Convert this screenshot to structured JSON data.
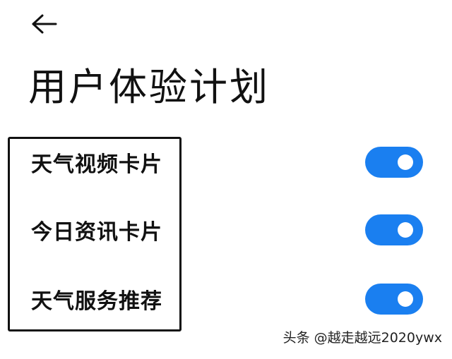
{
  "header": {
    "back_icon": "arrow-left-icon",
    "title": "用户体验计划"
  },
  "settings": [
    {
      "label": "天气视频卡片",
      "enabled": true
    },
    {
      "label": "今日资讯卡片",
      "enabled": true
    },
    {
      "label": "天气服务推荐",
      "enabled": true
    }
  ],
  "watermark": "头条 @越走越远2020ywx",
  "colors": {
    "toggle_on": "#1a7ff0",
    "background": "#ffffff",
    "text": "#111111"
  }
}
